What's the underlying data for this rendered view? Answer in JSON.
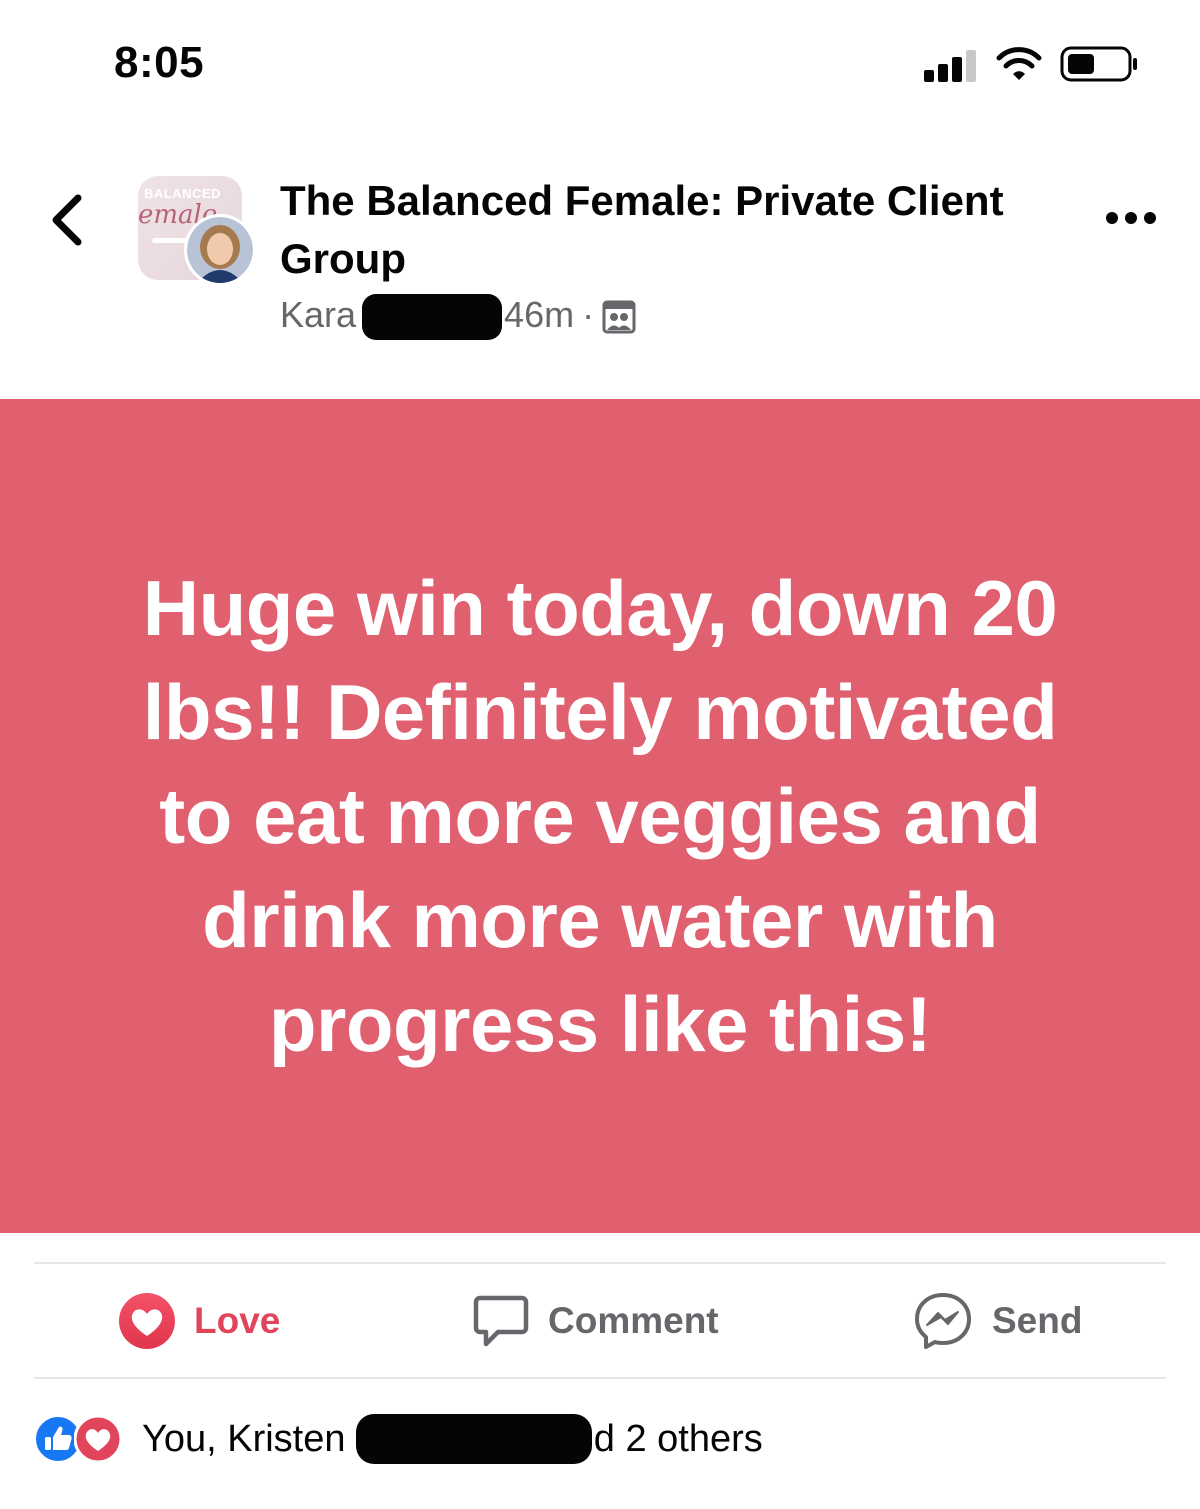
{
  "status_bar": {
    "time": "8:05"
  },
  "header": {
    "group_name": "The Balanced Female: Private Client Group",
    "group_logo_text": "BALANCED",
    "group_logo_script": "emale",
    "author_first_name": "Kara",
    "time_ago": "46m",
    "separator": "·"
  },
  "post": {
    "background_color": "#e06070",
    "text": "Huge win today, down 20 lbs!! Definitely motivated to eat more veggies and drink more water with progress like this!"
  },
  "actions": {
    "love_label": "Love",
    "comment_label": "Comment",
    "send_label": "Send"
  },
  "reactions": {
    "prefix": "You, Kristen",
    "suffix": "and 2 others",
    "icons": [
      "like-icon",
      "heart-icon"
    ]
  },
  "colors": {
    "love_red": "#e0455b",
    "like_blue": "#1877f2",
    "secondary_text": "#65676b"
  }
}
